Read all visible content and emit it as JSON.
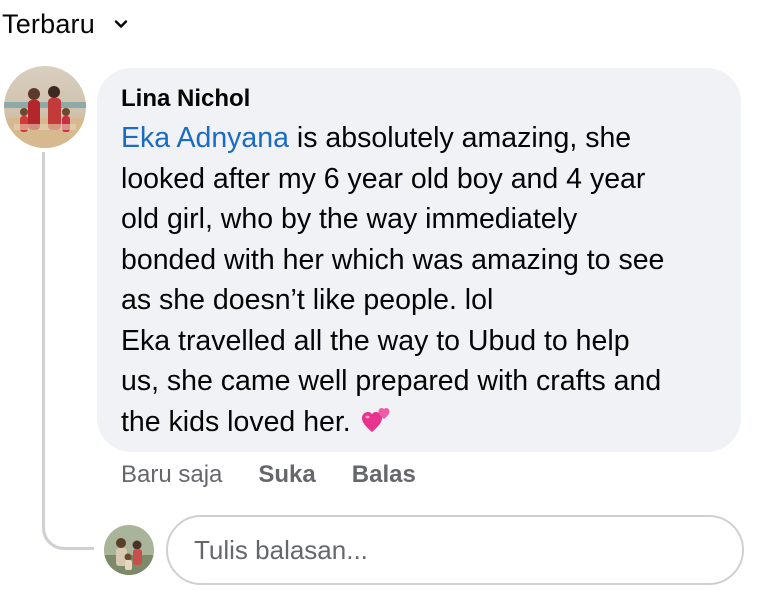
{
  "sort": {
    "label": "Terbaru",
    "icon": "chevron-down-icon"
  },
  "comment": {
    "author": "Lina Nichol",
    "mention": "Eka Adnyana",
    "text_after_mention": " is absolutely amazing, she\nlooked after my 6 year old boy and 4 year\nold girl, who by the way immediately\nbonded with her which was amazing to see\nas she doesn’t like people. lol\nEka travelled all the way to Ubud to help\nus, she came well prepared with crafts and\nthe kids loved her. ",
    "emoji": "two-hearts-icon",
    "mention_color": "#1b6bc2",
    "bubble_color": "#f0f2f5"
  },
  "actions": {
    "time": "Baru saja",
    "like": "Suka",
    "reply": "Balas"
  },
  "reply_box": {
    "placeholder": "Tulis balasan..."
  }
}
